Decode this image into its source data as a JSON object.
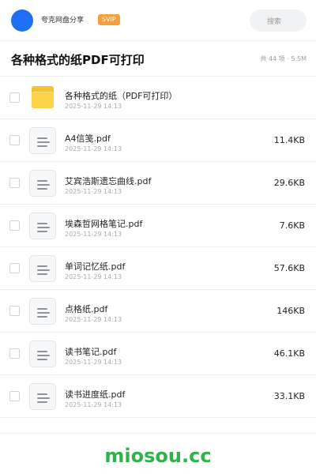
{
  "header": {
    "user_name": "夸克网盘分享",
    "vip_badge": "SVIP",
    "search_placeholder": "搜索"
  },
  "page": {
    "title": "各种格式的纸PDF可打印",
    "item_count": "共 44 项",
    "separator": "·",
    "total_size": "5.5M"
  },
  "files": [
    {
      "name": "各种格式的纸（PDF可打印）",
      "date": "2025-11-29 14:13",
      "size": "",
      "type": "folder"
    },
    {
      "name": "A4信笺.pdf",
      "date": "2025-11-29 14:13",
      "size": "11.4KB",
      "type": "pdf"
    },
    {
      "name": "艾宾浩斯遗忘曲线.pdf",
      "date": "2025-11-29 14:13",
      "size": "29.6KB",
      "type": "pdf"
    },
    {
      "name": "埃森哲网格笔记.pdf",
      "date": "2025-11-29 14:13",
      "size": "7.6KB",
      "type": "pdf"
    },
    {
      "name": "单词记忆纸.pdf",
      "date": "2025-11-29 14:13",
      "size": "57.6KB",
      "type": "pdf"
    },
    {
      "name": "点格纸.pdf",
      "date": "2025-11-29 14:13",
      "size": "146KB",
      "type": "pdf"
    },
    {
      "name": "读书笔记.pdf",
      "date": "2025-11-29 14:13",
      "size": "46.1KB",
      "type": "pdf"
    },
    {
      "name": "读书进度纸.pdf",
      "date": "2025-11-29 14:13",
      "size": "33.1KB",
      "type": "pdf"
    }
  ],
  "footer": {
    "watermark": "miosou.cc"
  },
  "colors": {
    "avatar": "#1f6ff5",
    "vip_badge": "#f5a03a",
    "folder": "#fdd34b",
    "watermark": "#2db34a"
  },
  "icons": {
    "folder": "folder-icon",
    "pdf": "document-icon"
  }
}
